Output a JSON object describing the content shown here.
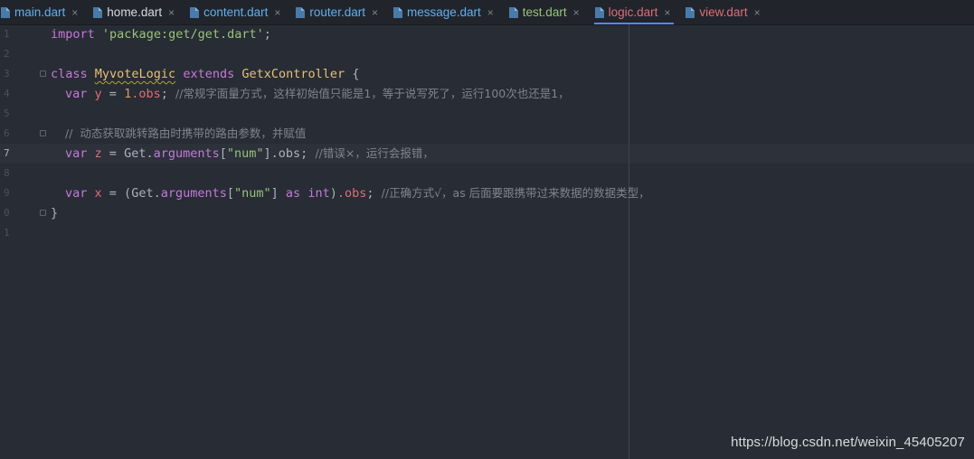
{
  "tabs": [
    {
      "label": "main.dart",
      "color": "#61afef",
      "close": "×",
      "active": false
    },
    {
      "label": "home.dart",
      "color": "#d7dae0",
      "close": "×",
      "active": false
    },
    {
      "label": "content.dart",
      "color": "#61afef",
      "close": "×",
      "active": false
    },
    {
      "label": "router.dart",
      "color": "#61afef",
      "close": "×",
      "active": false
    },
    {
      "label": "message.dart",
      "color": "#61afef",
      "close": "×",
      "active": false
    },
    {
      "label": "test.dart",
      "color": "#98c379",
      "close": "×",
      "active": false
    },
    {
      "label": "logic.dart",
      "color": "#e06c75",
      "close": "×",
      "active": true
    },
    {
      "label": "view.dart",
      "color": "#e06c75",
      "close": "×",
      "active": false
    }
  ],
  "gutter": {
    "line_numbers": [
      "1",
      "2",
      "3",
      "4",
      "5",
      "6",
      "7",
      "8",
      "9",
      "0",
      "1"
    ],
    "current_line": "7"
  },
  "code": {
    "line1": {
      "kw": "import",
      "str": "'package:get/get.dart'",
      "end": ";"
    },
    "line3": {
      "kw_class": "class",
      "name": "MyvoteLogic",
      "kw_extends": "extends",
      "parent": "GetxController",
      "brace": "{"
    },
    "line4": {
      "kw": "var",
      "var": "y",
      "eq": " = ",
      "num": "1",
      "prop": ".obs",
      "end": "; ",
      "comment": "//常规字面量方式，这样初始值只能是1，等于说写死了，运行100次也还是1，"
    },
    "line6": {
      "comment": "//  动态获取跳转路由时携带的路由参数，并赋值"
    },
    "line7": {
      "kw": "var",
      "var": "z",
      "eq": " = ",
      "obj": "Get",
      "dot": ".",
      "method": "arguments",
      "open": "[",
      "str": "\"num\"",
      "close": "]",
      "rest": ".obs; ",
      "comment": "//错误×，运行会报错，"
    },
    "line9": {
      "kw": "var",
      "var": "x",
      "eq": " = (",
      "obj": "Get",
      "dot": ".",
      "method": "arguments",
      "open": "[",
      "str": "\"num\"",
      "close": "] ",
      "kw_as": "as",
      "sp": " ",
      "type": "int",
      "paren": ")",
      "prop": ".obs",
      "end": "; ",
      "comment": "//正确方式√，as 后面要跟携带过来数据的数据类型，"
    },
    "line10": {
      "brace": "}"
    }
  },
  "watermark": "https://blog.csdn.net/weixin_45405207",
  "colors": {
    "background": "#282c34",
    "tabbar": "#21252b",
    "active_underline": "#528bff",
    "keyword": "#c678dd",
    "string": "#98c379",
    "class_name": "#e5c07b",
    "variable": "#e06c75",
    "number": "#d19a66",
    "comment": "#7f848e"
  },
  "icons": {
    "tab_file": "dart-file-icon",
    "tab_close": "close-icon",
    "fold": "fold-marker-icon"
  }
}
